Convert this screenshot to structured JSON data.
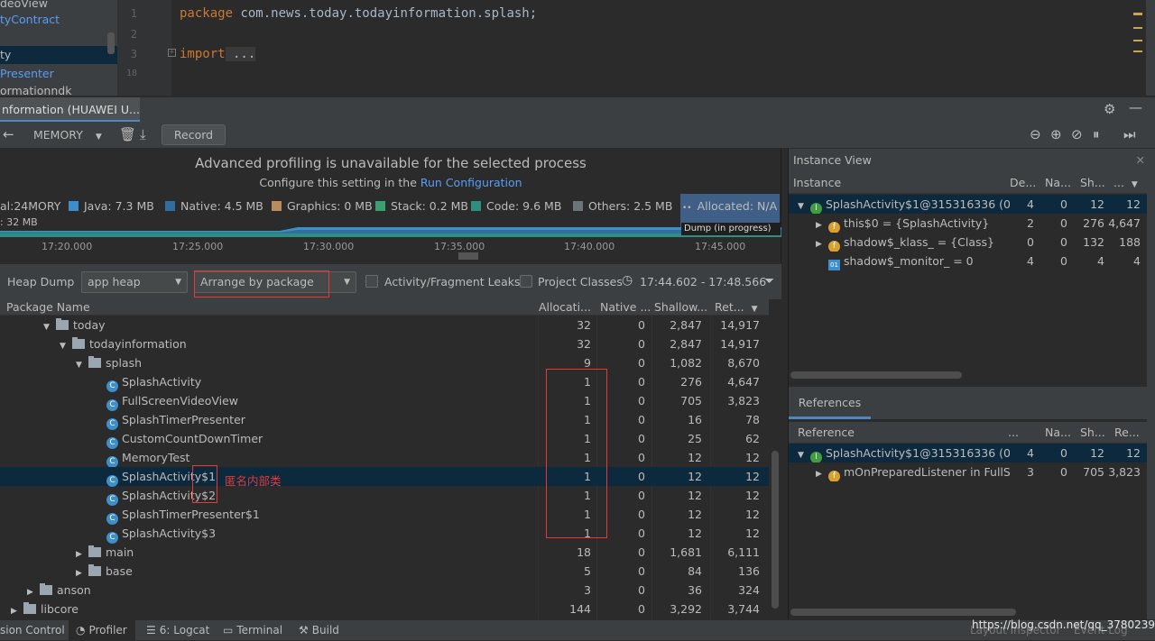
{
  "project_tree": {
    "items": [
      "deoView",
      "tyContract",
      "",
      "ty",
      "Presenter",
      "ormationndk"
    ]
  },
  "editor": {
    "line_numbers": [
      "1",
      "2",
      "3",
      "18"
    ],
    "line1_kw": "package",
    "line1_rest": " com.news.today.todayinformation.splash;",
    "line3_kw": "import",
    "line3_rest": " ..."
  },
  "profiler": {
    "tab_title": "nformation (HUAWEI U...",
    "memory_label": "MEMORY",
    "record_label": "Record"
  },
  "timeline": {
    "unavailable_title": "Advanced profiling is unavailable for the selected process",
    "configure_text": "Configure this setting in the ",
    "configure_link": "Run Configuration",
    "total_label": "al:24MORY",
    "sub_label": ": 32 MB",
    "legend": [
      {
        "label": "Java: 7.3 MB",
        "color": "#3d8ec9"
      },
      {
        "label": "Native: 4.5 MB",
        "color": "#2f6e9f"
      },
      {
        "label": "Graphics: 0 MB",
        "color": "#b88c5f"
      },
      {
        "label": "Stack: 0.2 MB",
        "color": "#3aa072"
      },
      {
        "label": "Code: 9.6 MB",
        "color": "#2e8f7f"
      },
      {
        "label": "Others: 2.5 MB",
        "color": "#6a7479"
      }
    ],
    "allocated": "Allocated: N/A",
    "dump_tooltip": "Dump (in progress)",
    "axis": [
      "17:20.000",
      "17:25.000",
      "17:30.000",
      "17:35.000",
      "17:40.000",
      "17:45.000"
    ]
  },
  "heap_toolbar": {
    "heap_dump_label": "Heap Dump",
    "heap_select": "app heap",
    "arrange_select": "Arrange by package",
    "leaks_label": "Activity/Fragment Leaks",
    "project_classes_label": "Project Classes",
    "time_range": "17:44.602 - 17:48.566"
  },
  "table": {
    "headers": {
      "name": "Package Name",
      "alloc": "Allocati...",
      "native": "Native ...",
      "shallow": "Shallow...",
      "retained": "Ret..."
    },
    "rows": [
      {
        "name": "today",
        "type": "folder",
        "indent": 48,
        "expand": "▼",
        "alloc": "32",
        "native": "0",
        "shallow": "2,847",
        "retained": "14,917"
      },
      {
        "name": "todayinformation",
        "type": "folder",
        "indent": 66,
        "expand": "▼",
        "alloc": "32",
        "native": "0",
        "shallow": "2,847",
        "retained": "14,917"
      },
      {
        "name": "splash",
        "type": "folder",
        "indent": 84,
        "expand": "▼",
        "alloc": "9",
        "native": "0",
        "shallow": "1,082",
        "retained": "8,670"
      },
      {
        "name": "SplashActivity",
        "type": "class",
        "indent": 118,
        "expand": "",
        "alloc": "1",
        "native": "0",
        "shallow": "276",
        "retained": "4,647"
      },
      {
        "name": "FullScreenVideoView",
        "type": "class",
        "indent": 118,
        "expand": "",
        "alloc": "1",
        "native": "0",
        "shallow": "705",
        "retained": "3,823"
      },
      {
        "name": "SplashTimerPresenter",
        "type": "class",
        "indent": 118,
        "expand": "",
        "alloc": "1",
        "native": "0",
        "shallow": "16",
        "retained": "78"
      },
      {
        "name": "CustomCountDownTimer",
        "type": "class",
        "indent": 118,
        "expand": "",
        "alloc": "1",
        "native": "0",
        "shallow": "25",
        "retained": "62"
      },
      {
        "name": "MemoryTest",
        "type": "class",
        "indent": 118,
        "expand": "",
        "alloc": "1",
        "native": "0",
        "shallow": "12",
        "retained": "12"
      },
      {
        "name": "SplashActivity$1",
        "type": "class",
        "indent": 118,
        "expand": "",
        "alloc": "1",
        "native": "0",
        "shallow": "12",
        "retained": "12"
      },
      {
        "name": "SplashActivity$2",
        "type": "class",
        "indent": 118,
        "expand": "",
        "alloc": "1",
        "native": "0",
        "shallow": "12",
        "retained": "12"
      },
      {
        "name": "SplashTimerPresenter$1",
        "type": "class",
        "indent": 118,
        "expand": "",
        "alloc": "1",
        "native": "0",
        "shallow": "12",
        "retained": "12"
      },
      {
        "name": "SplashActivity$3",
        "type": "class",
        "indent": 118,
        "expand": "",
        "alloc": "1",
        "native": "0",
        "shallow": "12",
        "retained": "12"
      },
      {
        "name": "main",
        "type": "folder",
        "indent": 84,
        "expand": "▶",
        "alloc": "18",
        "native": "0",
        "shallow": "1,681",
        "retained": "6,111"
      },
      {
        "name": "base",
        "type": "folder",
        "indent": 84,
        "expand": "▶",
        "alloc": "5",
        "native": "0",
        "shallow": "84",
        "retained": "136"
      },
      {
        "name": "anson",
        "type": "folder",
        "indent": 30,
        "expand": "▶",
        "alloc": "3",
        "native": "0",
        "shallow": "36",
        "retained": "324"
      },
      {
        "name": "libcore",
        "type": "folder",
        "indent": 12,
        "expand": "▶",
        "alloc": "144",
        "native": "0",
        "shallow": "3,292",
        "retained": "3,744"
      }
    ],
    "annotation": "匿名内部类"
  },
  "instance_view": {
    "title": "Instance View",
    "headers": {
      "instance": "Instance",
      "depth": "De...",
      "native": "Na...",
      "shallow": "Sh...",
      "retained": "..."
    },
    "rows": [
      {
        "expand": "▼",
        "icon": "green",
        "name": "SplashActivity$1@315316336 (0x",
        "depth": "4",
        "native": "0",
        "shallow": "12",
        "retained": "12",
        "indent": 10
      },
      {
        "expand": "▶",
        "icon": "orange",
        "name": "this$0 = {SplashActivity}",
        "depth": "2",
        "native": "0",
        "shallow": "276",
        "retained": "4,647",
        "indent": 30
      },
      {
        "expand": "▶",
        "icon": "orange",
        "name": "shadow$_klass_ = {Class}",
        "depth": "0",
        "native": "0",
        "shallow": "132",
        "retained": "188",
        "indent": 30
      },
      {
        "expand": "",
        "icon": "blue",
        "name": "shadow$_monitor_ = 0",
        "depth": "4",
        "native": "0",
        "shallow": "4",
        "retained": "4",
        "indent": 30
      }
    ]
  },
  "references": {
    "tab": "References",
    "headers": {
      "reference": "Reference",
      "depth": "...",
      "native": "Na...",
      "shallow": "Sh...",
      "retained": "Re..."
    },
    "rows": [
      {
        "expand": "▼",
        "icon": "green",
        "name": "SplashActivity$1@315316336 (0x",
        "depth": "4",
        "native": "0",
        "shallow": "12",
        "retained": "12",
        "indent": 10
      },
      {
        "expand": "▶",
        "icon": "orange",
        "name": "mOnPreparedListener in FullSc",
        "depth": "3",
        "native": "0",
        "shallow": "705",
        "retained": "3,823",
        "indent": 30
      }
    ]
  },
  "statusbar": {
    "version_control": "sion Control",
    "profiler": "Profiler",
    "logcat": "6: Logcat",
    "terminal": "Terminal",
    "build": "Build",
    "layout_inspector": "Layout Inspector",
    "event_log": "Event Log",
    "watermark": "https://blog.csdn.net/qq_37802398"
  }
}
